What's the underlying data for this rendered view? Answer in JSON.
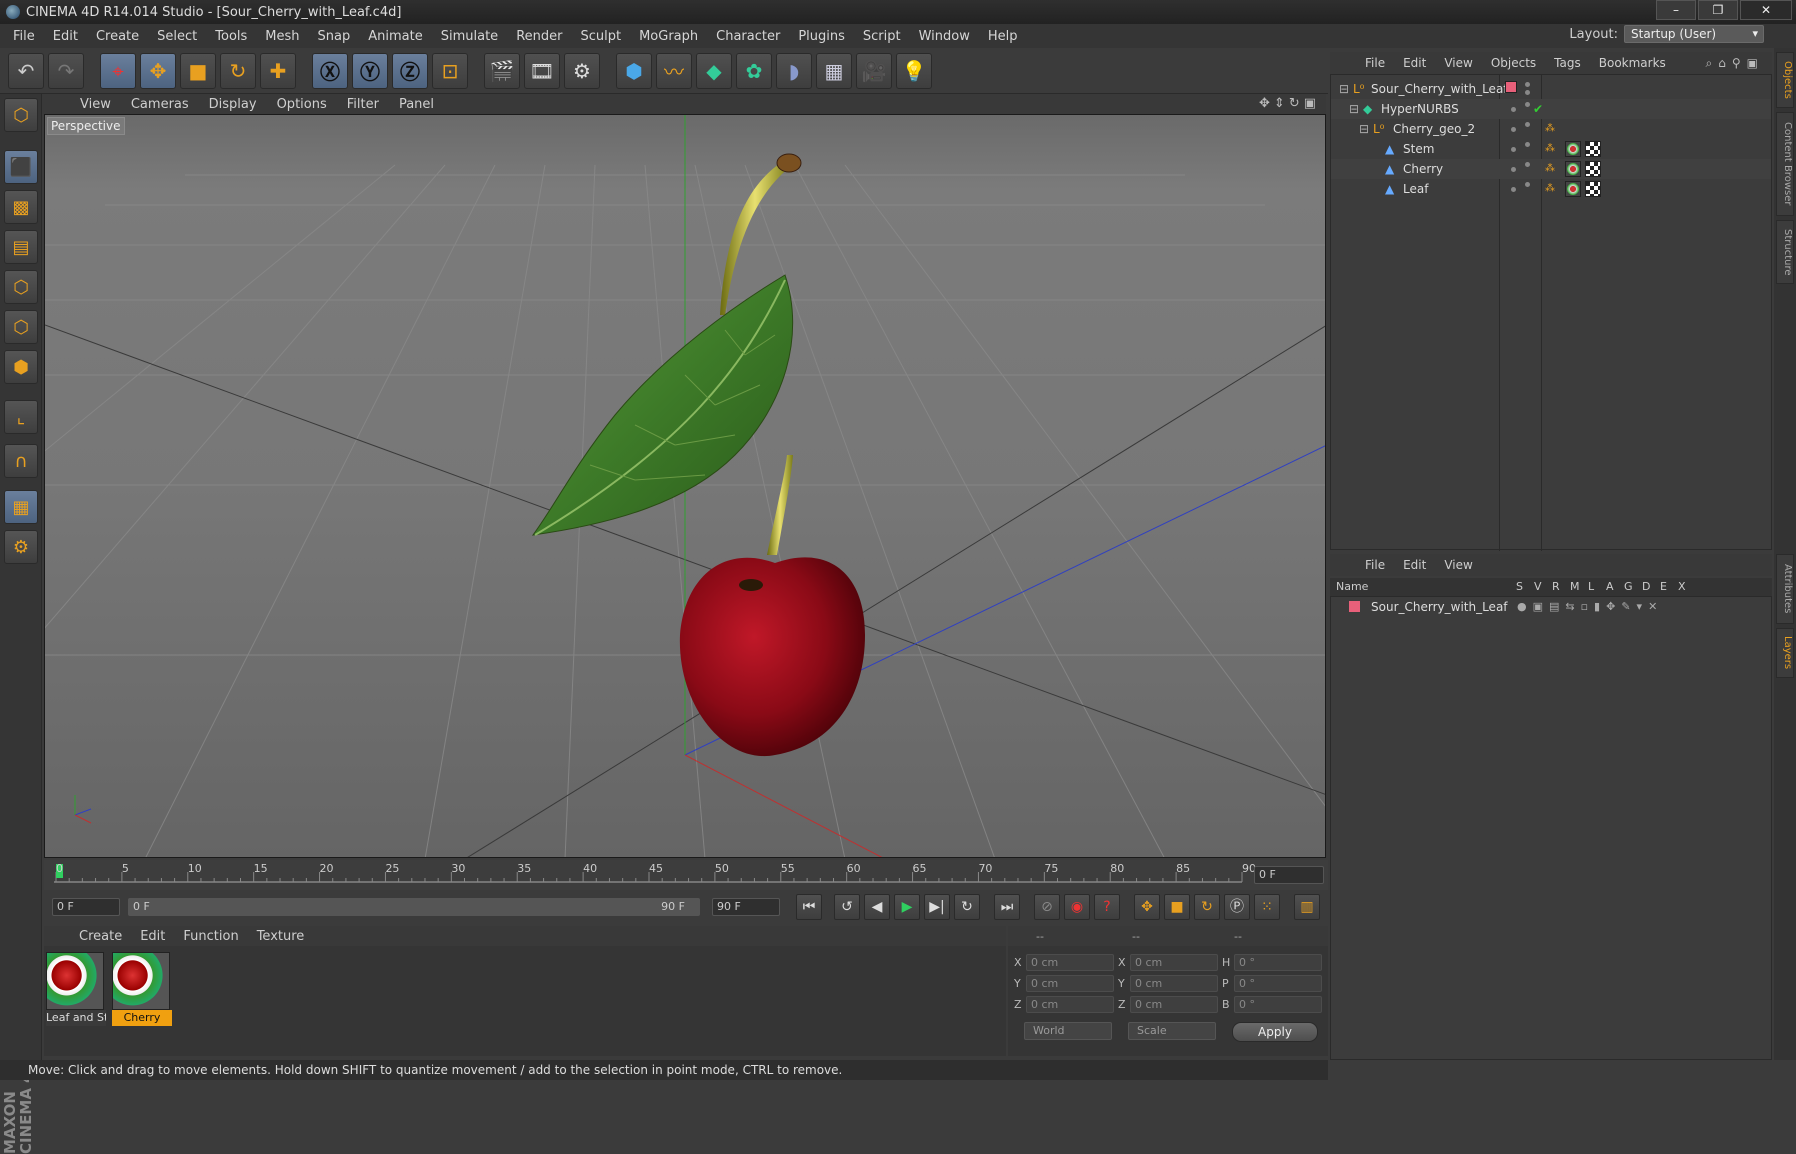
{
  "window": {
    "title": "CINEMA 4D R14.014 Studio - [Sour_Cherry_with_Leaf.c4d]"
  },
  "menu": [
    "File",
    "Edit",
    "Create",
    "Select",
    "Tools",
    "Mesh",
    "Snap",
    "Animate",
    "Simulate",
    "Render",
    "Sculpt",
    "MoGraph",
    "Character",
    "Plugins",
    "Script",
    "Window",
    "Help"
  ],
  "layout": {
    "label": "Layout:",
    "value": "Startup (User)"
  },
  "viewport": {
    "menu": [
      "View",
      "Cameras",
      "Display",
      "Options",
      "Filter",
      "Panel"
    ],
    "label": "Perspective"
  },
  "timeline": {
    "ticks": [
      "0",
      "5",
      "10",
      "15",
      "20",
      "25",
      "30",
      "35",
      "40",
      "45",
      "50",
      "55",
      "60",
      "65",
      "70",
      "75",
      "80",
      "85",
      "90"
    ],
    "current_frame": "0 F",
    "start_field": "0 F",
    "range_start": "0 F",
    "range_end": "90 F",
    "end_field": "90 F"
  },
  "materials": {
    "menu": [
      "Create",
      "Edit",
      "Function",
      "Texture"
    ],
    "items": [
      {
        "label": "Leaf and St",
        "selected": false
      },
      {
        "label": "Cherry",
        "selected": true
      }
    ]
  },
  "coords": {
    "headers": [
      "--",
      "--",
      "--"
    ],
    "rows": [
      {
        "a": "X",
        "av": "0 cm",
        "b": "X",
        "bv": "0 cm",
        "c": "H",
        "cv": "0 °"
      },
      {
        "a": "Y",
        "av": "0 cm",
        "b": "Y",
        "bv": "0 cm",
        "c": "P",
        "cv": "0 °"
      },
      {
        "a": "Z",
        "av": "0 cm",
        "b": "Z",
        "bv": "0 cm",
        "c": "B",
        "cv": "0 °"
      }
    ],
    "mode1": "World",
    "mode2": "Scale",
    "apply": "Apply"
  },
  "objects": {
    "menu": [
      "File",
      "Edit",
      "View",
      "Objects",
      "Tags",
      "Bookmarks"
    ],
    "tree": [
      {
        "name": "Sour_Cherry_with_Leaf",
        "indent": 0,
        "icon": "null-icon"
      },
      {
        "name": "HyperNURBS",
        "indent": 1,
        "icon": "hypernurbs-icon"
      },
      {
        "name": "Cherry_geo_2",
        "indent": 2,
        "icon": "null-icon"
      },
      {
        "name": "Stem",
        "indent": 3,
        "icon": "polygon-icon"
      },
      {
        "name": "Cherry",
        "indent": 3,
        "icon": "polygon-icon"
      },
      {
        "name": "Leaf",
        "indent": 3,
        "icon": "polygon-icon"
      }
    ]
  },
  "layers": {
    "menu": [
      "File",
      "Edit",
      "View"
    ],
    "columns": [
      "Name",
      "S",
      "V",
      "R",
      "M",
      "L",
      "A",
      "G",
      "D",
      "E",
      "X"
    ],
    "rows": [
      {
        "name": "Sour_Cherry_with_Leaf",
        "color": "#e8607a"
      }
    ]
  },
  "side_tabs": [
    "Objects",
    "Content Browser",
    "Structure",
    "Attributes",
    "Layers"
  ],
  "status": "Move: Click and drag to move elements. Hold down SHIFT to quantize movement / add to the selection in point mode, CTRL to remove.",
  "logo": "MAXON CINEMA 4D",
  "colors": {
    "accent": "#f0a010",
    "selection": "#5a7090",
    "axis_x": "#c03030",
    "axis_y": "#30a030",
    "axis_z": "#3040c0"
  }
}
